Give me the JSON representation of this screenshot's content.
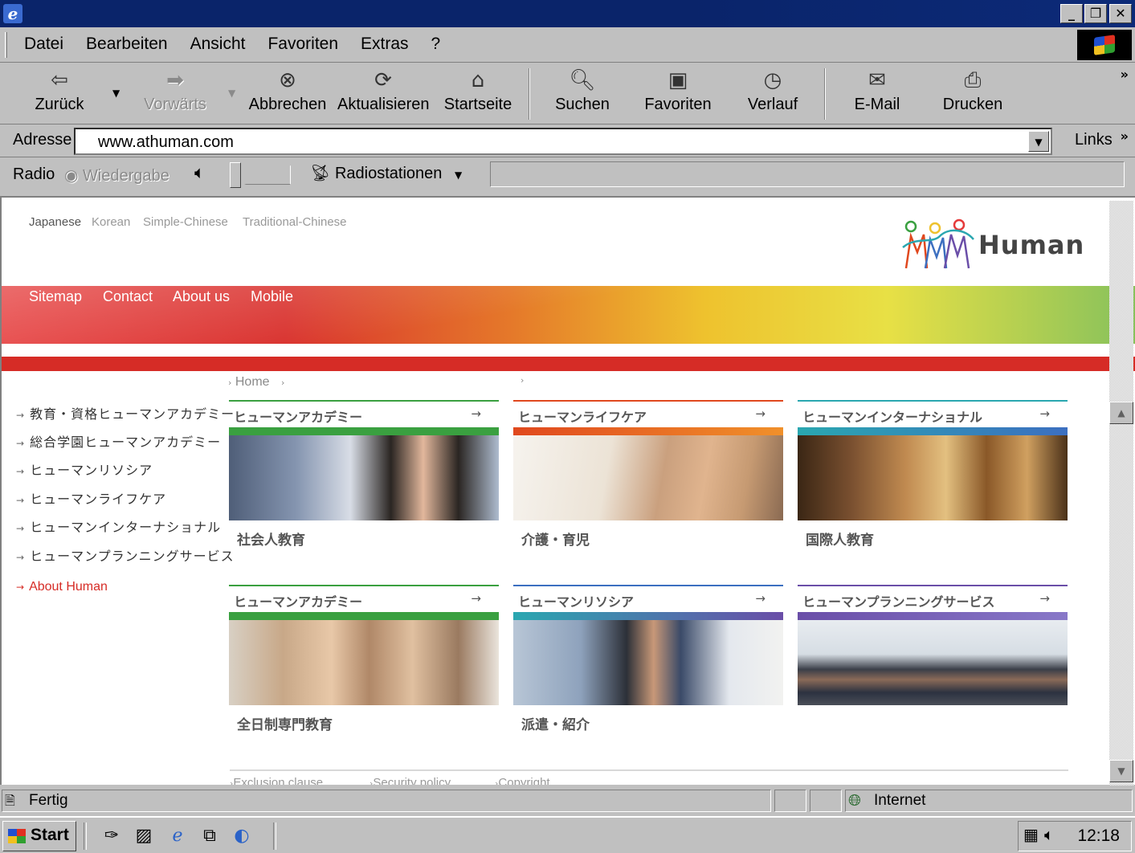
{
  "window": {
    "min_glyph": "_",
    "max_glyph": "❐",
    "close_glyph": "✕"
  },
  "menu": {
    "items": [
      "Datei",
      "Bearbeiten",
      "Ansicht",
      "Favoriten",
      "Extras",
      "?"
    ]
  },
  "toolbar": {
    "back": "Zurück",
    "forward": "Vorwärts",
    "stop": "Abbrechen",
    "refresh": "Aktualisieren",
    "home": "Startseite",
    "search": "Suchen",
    "favorites": "Favoriten",
    "history": "Verlauf",
    "mail": "E-Mail",
    "print": "Drucken"
  },
  "address": {
    "label": "Adresse",
    "url": "www.athuman.com",
    "links": "Links"
  },
  "radio": {
    "label": "Radio",
    "playback": "Wiedergabe",
    "stations": "Radiostationen"
  },
  "page": {
    "languages": [
      "Japanese",
      "Korean",
      "Simple-Chinese",
      "Traditional-Chinese"
    ],
    "logo_text": "Human",
    "topnav": [
      "Sitemap",
      "Contact",
      "About us",
      "Mobile"
    ],
    "breadcrumb": {
      "home": "Home"
    },
    "sidebar": [
      "教育・資格ヒューマンアカデミー",
      "総合学園ヒューマンアカデミー",
      "ヒューマンリソシア",
      "ヒューマンライフケア",
      "ヒューマンインターナショナル",
      "ヒューマンプランニングサービス"
    ],
    "about": "About Human",
    "cards": [
      {
        "title": "ヒューマンアカデミー",
        "caption": "社会人教育",
        "color": "#3aa040"
      },
      {
        "title": "ヒューマンライフケア",
        "caption": "介護・育児",
        "color": "#e0481e"
      },
      {
        "title": "ヒューマンインターナショナル",
        "caption": "国際人教育",
        "color": "#2aa7b0"
      },
      {
        "title": "ヒューマンアカデミー",
        "caption": "全日制専門教育",
        "color": "#3aa040"
      },
      {
        "title": "ヒューマンリソシア",
        "caption": "派遣・紹介",
        "color": "#3c6fc0"
      },
      {
        "title": "ヒューマンプランニングサービス",
        "caption": "",
        "color": "#6a4ea8"
      }
    ],
    "footer": [
      "Exclusion clause",
      "Security policy",
      "Copyright"
    ]
  },
  "status": {
    "text": "Fertig",
    "zone": "Internet"
  },
  "taskbar": {
    "start": "Start",
    "clock": "12:18"
  }
}
